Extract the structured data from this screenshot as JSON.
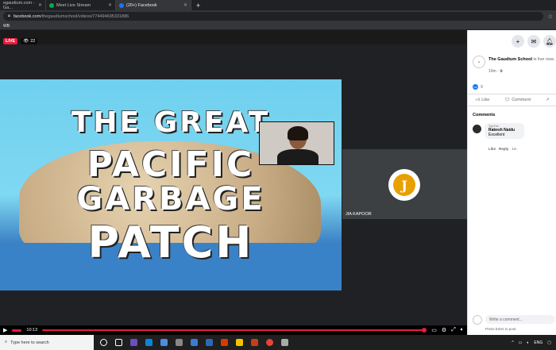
{
  "browser": {
    "tabs": [
      {
        "label": "egaudium.com - Ga...",
        "active": false
      },
      {
        "label": "Meet Live Stream",
        "active": false
      },
      {
        "label": "(20+) Facebook",
        "active": true
      }
    ],
    "new_tab": "+",
    "url_host": "facebook.com",
    "url_path": "/thegaudiumschool/videos/774494695331886",
    "bookmark": "WB"
  },
  "video": {
    "live_label": "LIVE",
    "viewer_count": "22",
    "slide_title": [
      "THE GREAT",
      "PACIFIC",
      "GARBAGE",
      "PATCH"
    ],
    "participant_name": "JIA KAPOOR",
    "avatar_letter": "J",
    "time": "10:13",
    "progress": 1.0
  },
  "facebook": {
    "page_name": "The Gaudium School",
    "live_text": "is live now.",
    "post_time": "10m ·",
    "reaction_count": "9",
    "like_label": "Like",
    "comment_label": "Comment",
    "comments_heading": "Comments",
    "comment": {
      "badge": "Top Fan",
      "author": "Rakesh Naidu",
      "text": "Excellent",
      "like": "Like",
      "reply": "Reply",
      "age": "1m"
    },
    "write_placeholder": "Write a comment...",
    "write_hint": "Press Enter to post."
  },
  "taskbar": {
    "search_text": "Type here to search",
    "language": "ENG"
  },
  "colors": {
    "live_red": "#e41e3f",
    "fb_blue": "#1877f2",
    "meet_gray": "#3c4043"
  }
}
